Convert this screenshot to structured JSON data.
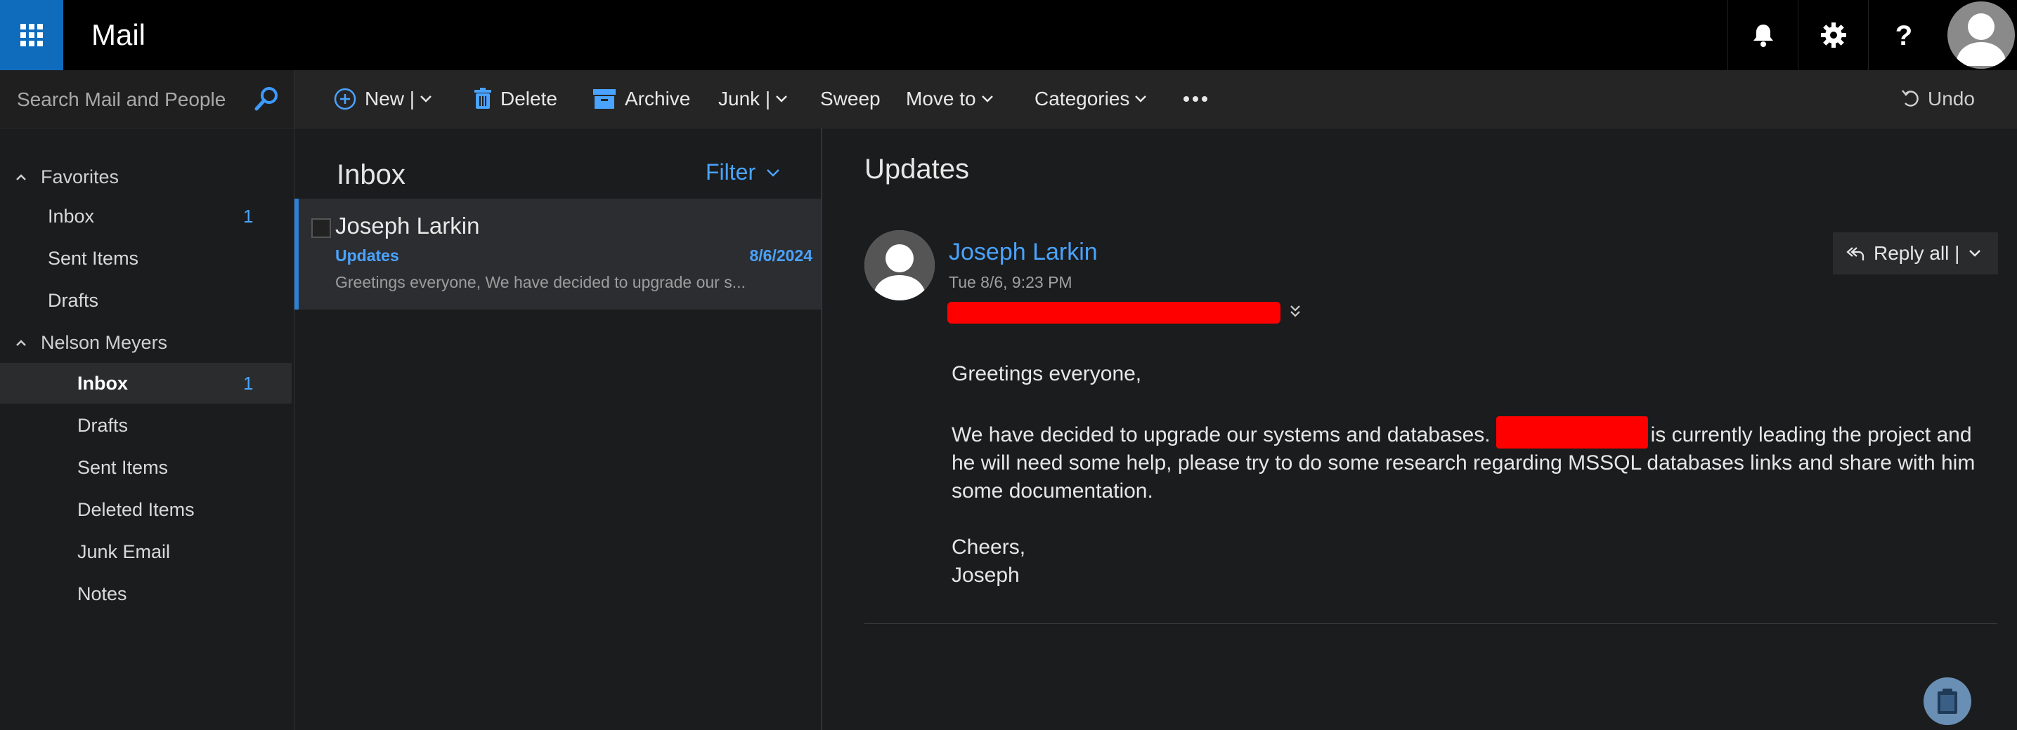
{
  "app": {
    "title": "Mail"
  },
  "topbar": {
    "icons": [
      "waffle-icon",
      "bell-icon",
      "gear-icon",
      "help-icon",
      "avatar"
    ]
  },
  "search": {
    "placeholder": "Search Mail and People"
  },
  "toolbar": {
    "new_label": "New |",
    "delete_label": "Delete",
    "archive_label": "Archive",
    "junk_label": "Junk |",
    "sweep_label": "Sweep",
    "moveto_label": "Move to",
    "categories_label": "Categories",
    "undo_label": "Undo"
  },
  "nav": {
    "favorites": {
      "label": "Favorites",
      "items": [
        {
          "label": "Inbox",
          "count": "1"
        },
        {
          "label": "Sent Items",
          "count": ""
        },
        {
          "label": "Drafts",
          "count": ""
        }
      ]
    },
    "account": {
      "label": "Nelson Meyers",
      "items": [
        {
          "label": "Inbox",
          "count": "1"
        },
        {
          "label": "Drafts",
          "count": ""
        },
        {
          "label": "Sent Items",
          "count": ""
        },
        {
          "label": "Deleted Items",
          "count": ""
        },
        {
          "label": "Junk Email",
          "count": ""
        },
        {
          "label": "Notes",
          "count": ""
        }
      ]
    }
  },
  "list": {
    "title": "Inbox",
    "filter_label": "Filter",
    "messages": [
      {
        "from": "Joseph Larkin",
        "subject": "Updates",
        "date": "8/6/2024",
        "preview": "Greetings everyone,   We have decided to upgrade our s..."
      }
    ]
  },
  "reading": {
    "subject": "Updates",
    "sender": "Joseph Larkin",
    "time": "Tue 8/6, 9:23 PM",
    "reply_all_label": "Reply all  |",
    "body": {
      "greeting": "Greetings everyone,",
      "para_start": "We have decided to upgrade our systems and databases.",
      "para_end": "is currently leading the project and he will need some help, please try to do some research regarding MSSQL databases links and share with him some documentation.",
      "closing": "Cheers,",
      "signature": "Joseph"
    }
  },
  "colors": {
    "accent": "#0f6cbd",
    "link_blue": "#4aa3ff",
    "background": "#1b1c1d",
    "redaction": "#ff0000"
  }
}
